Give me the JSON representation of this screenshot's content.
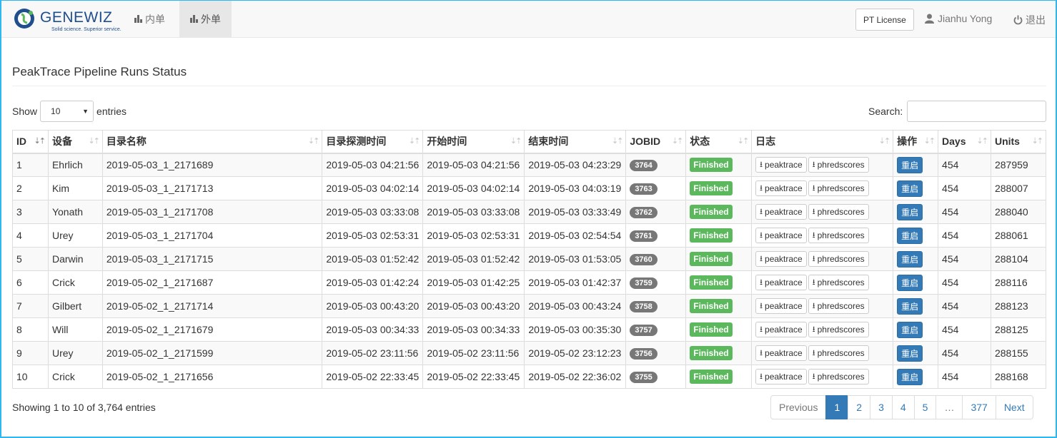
{
  "navbar": {
    "brand": "GENEWIZ",
    "tagline": "Solid science. Superior service.",
    "tabs": [
      {
        "label": "内单",
        "active": false
      },
      {
        "label": "外单",
        "active": true
      }
    ],
    "license_button": "PT License",
    "user": "Jianhu Yong",
    "logout": "退出"
  },
  "page_title": "PeakTrace Pipeline Runs Status",
  "length_menu": {
    "prefix": "Show",
    "value": "10",
    "suffix": "entries"
  },
  "search": {
    "label": "Search:",
    "value": ""
  },
  "columns": [
    "ID",
    "设备",
    "目录名称",
    "目录探测时间",
    "开始时间",
    "结束时间",
    "JOBID",
    "状态",
    "日志",
    "操作",
    "Days",
    "Units"
  ],
  "log_buttons": {
    "peaktrace": "peaktrace",
    "phredscores": "phredscores"
  },
  "action_label": "重启",
  "rows": [
    {
      "id": "1",
      "device": "Ehrlich",
      "dir": "2019-05-03_1_2171689",
      "detect": "2019-05-03 04:21:56",
      "start": "2019-05-03 04:21:56",
      "end": "2019-05-03 04:23:29",
      "jobid": "3764",
      "status": "Finished",
      "days": "454",
      "units": "287959"
    },
    {
      "id": "2",
      "device": "Kim",
      "dir": "2019-05-03_1_2171713",
      "detect": "2019-05-03 04:02:14",
      "start": "2019-05-03 04:02:14",
      "end": "2019-05-03 04:03:19",
      "jobid": "3763",
      "status": "Finished",
      "days": "454",
      "units": "288007"
    },
    {
      "id": "3",
      "device": "Yonath",
      "dir": "2019-05-03_1_2171708",
      "detect": "2019-05-03 03:33:08",
      "start": "2019-05-03 03:33:08",
      "end": "2019-05-03 03:33:49",
      "jobid": "3762",
      "status": "Finished",
      "days": "454",
      "units": "288040"
    },
    {
      "id": "4",
      "device": "Urey",
      "dir": "2019-05-03_1_2171704",
      "detect": "2019-05-03 02:53:31",
      "start": "2019-05-03 02:53:31",
      "end": "2019-05-03 02:54:54",
      "jobid": "3761",
      "status": "Finished",
      "days": "454",
      "units": "288061"
    },
    {
      "id": "5",
      "device": "Darwin",
      "dir": "2019-05-03_1_2171715",
      "detect": "2019-05-03 01:52:42",
      "start": "2019-05-03 01:52:42",
      "end": "2019-05-03 01:53:05",
      "jobid": "3760",
      "status": "Finished",
      "days": "454",
      "units": "288104"
    },
    {
      "id": "6",
      "device": "Crick",
      "dir": "2019-05-02_1_2171687",
      "detect": "2019-05-03 01:42:24",
      "start": "2019-05-03 01:42:25",
      "end": "2019-05-03 01:42:37",
      "jobid": "3759",
      "status": "Finished",
      "days": "454",
      "units": "288116"
    },
    {
      "id": "7",
      "device": "Gilbert",
      "dir": "2019-05-02_1_2171714",
      "detect": "2019-05-03 00:43:20",
      "start": "2019-05-03 00:43:20",
      "end": "2019-05-03 00:43:24",
      "jobid": "3758",
      "status": "Finished",
      "days": "454",
      "units": "288123"
    },
    {
      "id": "8",
      "device": "Will",
      "dir": "2019-05-02_1_2171679",
      "detect": "2019-05-03 00:34:33",
      "start": "2019-05-03 00:34:33",
      "end": "2019-05-03 00:35:30",
      "jobid": "3757",
      "status": "Finished",
      "days": "454",
      "units": "288125"
    },
    {
      "id": "9",
      "device": "Urey",
      "dir": "2019-05-02_1_2171599",
      "detect": "2019-05-02 23:11:56",
      "start": "2019-05-02 23:11:56",
      "end": "2019-05-02 23:12:23",
      "jobid": "3756",
      "status": "Finished",
      "days": "454",
      "units": "288155"
    },
    {
      "id": "10",
      "device": "Crick",
      "dir": "2019-05-02_1_2171656",
      "detect": "2019-05-02 22:33:45",
      "start": "2019-05-02 22:33:45",
      "end": "2019-05-02 22:36:02",
      "jobid": "3755",
      "status": "Finished",
      "days": "454",
      "units": "288168"
    }
  ],
  "info": "Showing 1 to 10 of 3,764 entries",
  "pagination": {
    "previous": "Previous",
    "pages": [
      "1",
      "2",
      "3",
      "4",
      "5",
      "…",
      "377"
    ],
    "current": "1",
    "next": "Next"
  },
  "colors": {
    "primary": "#337ab7",
    "success": "#5cb85c",
    "badge": "#777777",
    "brand": "#1f4e8c"
  }
}
